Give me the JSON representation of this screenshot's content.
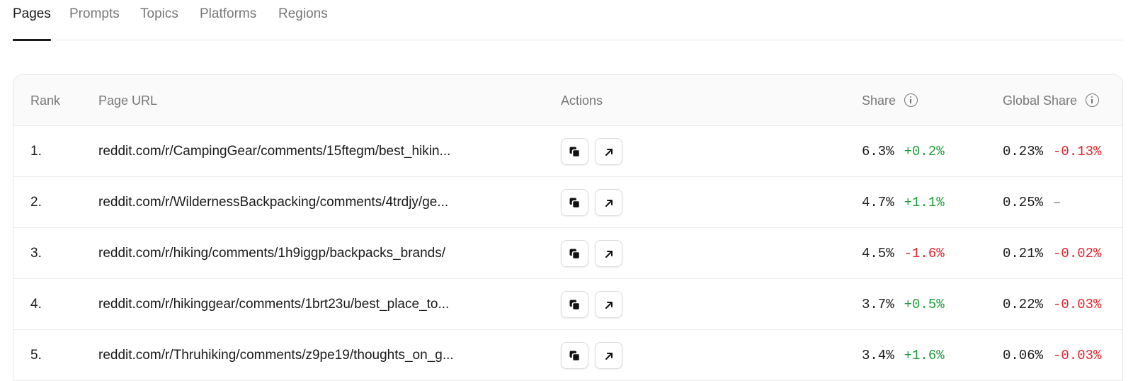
{
  "tabs": [
    {
      "label": "Pages",
      "active": true
    },
    {
      "label": "Prompts",
      "active": false
    },
    {
      "label": "Topics",
      "active": false
    },
    {
      "label": "Platforms",
      "active": false
    },
    {
      "label": "Regions",
      "active": false
    }
  ],
  "table": {
    "columns": {
      "rank": "Rank",
      "url": "Page URL",
      "actions": "Actions",
      "share": "Share",
      "global_share": "Global Share"
    },
    "rows": [
      {
        "rank": "1.",
        "url": "reddit.com/r/CampingGear/comments/15ftegm/best_hikin...",
        "share": "6.3%",
        "share_delta": "+0.2%",
        "share_trend": "up",
        "global_share": "0.23%",
        "global_delta": "-0.13%",
        "global_trend": "down"
      },
      {
        "rank": "2.",
        "url": "reddit.com/r/WildernessBackpacking/comments/4trdjy/ge...",
        "share": "4.7%",
        "share_delta": "+1.1%",
        "share_trend": "up",
        "global_share": "0.25%",
        "global_delta": "–",
        "global_trend": "none"
      },
      {
        "rank": "3.",
        "url": "reddit.com/r/hiking/comments/1h9iggp/backpacks_brands/",
        "share": "4.5%",
        "share_delta": "-1.6%",
        "share_trend": "down",
        "global_share": "0.21%",
        "global_delta": "-0.02%",
        "global_trend": "down"
      },
      {
        "rank": "4.",
        "url": "reddit.com/r/hikinggear/comments/1brt23u/best_place_to...",
        "share": "3.7%",
        "share_delta": "+0.5%",
        "share_trend": "up",
        "global_share": "0.22%",
        "global_delta": "-0.03%",
        "global_trend": "down"
      },
      {
        "rank": "5.",
        "url": "reddit.com/r/Thruhiking/comments/z9pe19/thoughts_on_g...",
        "share": "3.4%",
        "share_delta": "+1.6%",
        "share_trend": "up",
        "global_share": "0.06%",
        "global_delta": "-0.03%",
        "global_trend": "down"
      }
    ]
  },
  "icons": {
    "copy": "copy-icon",
    "open": "external-link-icon",
    "info": "info-icon"
  },
  "colors": {
    "positive": "#1f9d3a",
    "negative": "#e5242b",
    "neutral": "#777777"
  }
}
